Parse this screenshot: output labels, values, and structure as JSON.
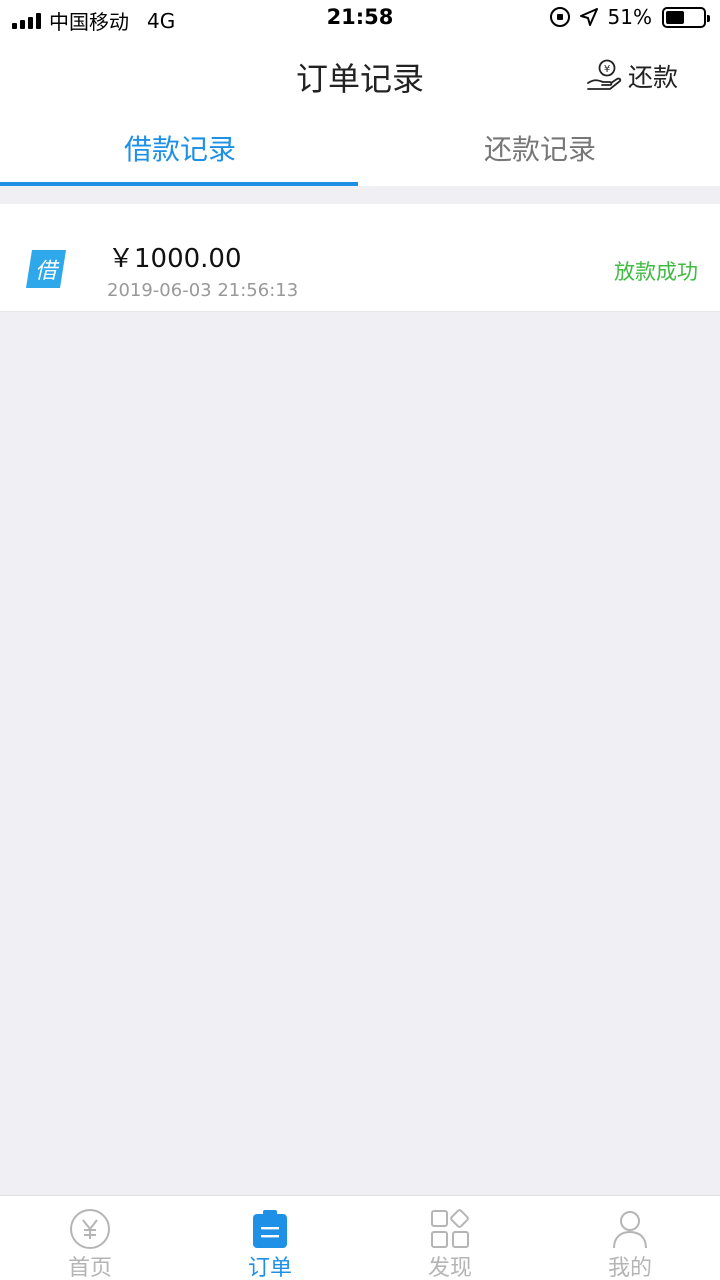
{
  "status_bar": {
    "carrier": "中国移动",
    "network": "4G",
    "time": "21:58",
    "battery_percent": "51%",
    "battery_level": 0.51
  },
  "navbar": {
    "title": "订单记录",
    "right_action": "还款"
  },
  "tabs": [
    {
      "label": "借款记录",
      "active": true
    },
    {
      "label": "还款记录",
      "active": false
    }
  ],
  "records": [
    {
      "icon_char": "借",
      "amount": "￥1000.00",
      "datetime": "2019-06-03 21:56:13",
      "status": "放款成功"
    }
  ],
  "tabbar": [
    {
      "label": "首页",
      "icon": "yen-circle-icon",
      "active": false
    },
    {
      "label": "订单",
      "icon": "clipboard-icon",
      "active": true
    },
    {
      "label": "发现",
      "icon": "grid-icon",
      "active": false
    },
    {
      "label": "我的",
      "icon": "person-icon",
      "active": false
    }
  ],
  "colors": {
    "accent": "#1e90e6",
    "success": "#3fba43",
    "inactive": "#b5b5b5",
    "background": "#efeff4"
  }
}
